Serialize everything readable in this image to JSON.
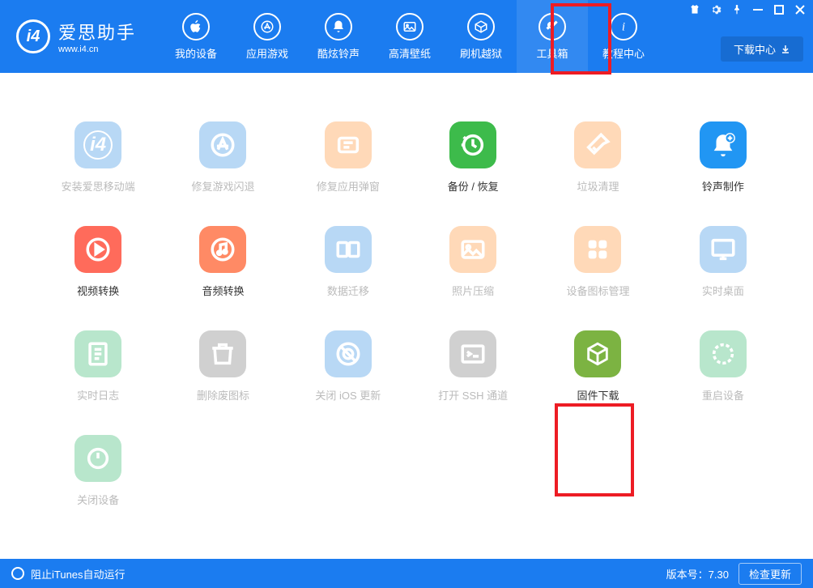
{
  "app": {
    "title": "爱思助手",
    "url": "www.i4.cn",
    "logo_text": "i4"
  },
  "titlebar": {
    "items": [
      "shirt",
      "gear",
      "pin",
      "minimize",
      "maximize",
      "close"
    ]
  },
  "nav": {
    "items": [
      {
        "label": "我的设备",
        "icon": "apple"
      },
      {
        "label": "应用游戏",
        "icon": "appstore"
      },
      {
        "label": "酷炫铃声",
        "icon": "bell"
      },
      {
        "label": "高清壁纸",
        "icon": "image"
      },
      {
        "label": "刷机越狱",
        "icon": "box"
      },
      {
        "label": "工具箱",
        "icon": "tools",
        "highlighted": true
      },
      {
        "label": "教程中心",
        "icon": "info"
      }
    ],
    "download_btn": "下载中心"
  },
  "tools": [
    {
      "label": "安装爱思移动端",
      "color": "#b8d8f5",
      "icon": "i4",
      "disabled": true
    },
    {
      "label": "修复游戏闪退",
      "color": "#b8d8f5",
      "icon": "appstore",
      "disabled": true
    },
    {
      "label": "修复应用弹窗",
      "color": "#ffd9b8",
      "icon": "appleid",
      "disabled": true
    },
    {
      "label": "备份 / 恢复",
      "color": "#3dbb4b",
      "icon": "restore",
      "disabled": false
    },
    {
      "label": "垃圾清理",
      "color": "#ffd9b8",
      "icon": "clean",
      "disabled": true
    },
    {
      "label": "铃声制作",
      "color": "#2196f3",
      "icon": "bell-plus",
      "disabled": false
    },
    {
      "label": "视频转换",
      "color": "#ff6b5b",
      "icon": "play",
      "disabled": false
    },
    {
      "label": "音频转换",
      "color": "#ff8a65",
      "icon": "music",
      "disabled": false
    },
    {
      "label": "数据迁移",
      "color": "#b8d8f5",
      "icon": "transfer",
      "disabled": true
    },
    {
      "label": "照片压缩",
      "color": "#ffd9b8",
      "icon": "photo",
      "disabled": true
    },
    {
      "label": "设备图标管理",
      "color": "#ffd9b8",
      "icon": "grid",
      "disabled": true
    },
    {
      "label": "实时桌面",
      "color": "#b8d8f5",
      "icon": "desktop",
      "disabled": true
    },
    {
      "label": "实时日志",
      "color": "#b8e6cc",
      "icon": "log",
      "disabled": true
    },
    {
      "label": "删除废图标",
      "color": "#d0d0d0",
      "icon": "trash",
      "disabled": true
    },
    {
      "label": "关闭 iOS 更新",
      "color": "#b8d8f5",
      "icon": "noupdate",
      "disabled": true
    },
    {
      "label": "打开 SSH 通道",
      "color": "#d0d0d0",
      "icon": "terminal",
      "disabled": true
    },
    {
      "label": "固件下载",
      "color": "#7cb342",
      "icon": "cube",
      "disabled": false
    },
    {
      "label": "重启设备",
      "color": "#b8e6cc",
      "icon": "restart",
      "disabled": true
    },
    {
      "label": "关闭设备",
      "color": "#b8e6cc",
      "icon": "power",
      "disabled": true
    }
  ],
  "footer": {
    "itunes_text": "阻止iTunes自动运行",
    "version_label": "版本号：7.30",
    "update_btn": "检查更新"
  }
}
